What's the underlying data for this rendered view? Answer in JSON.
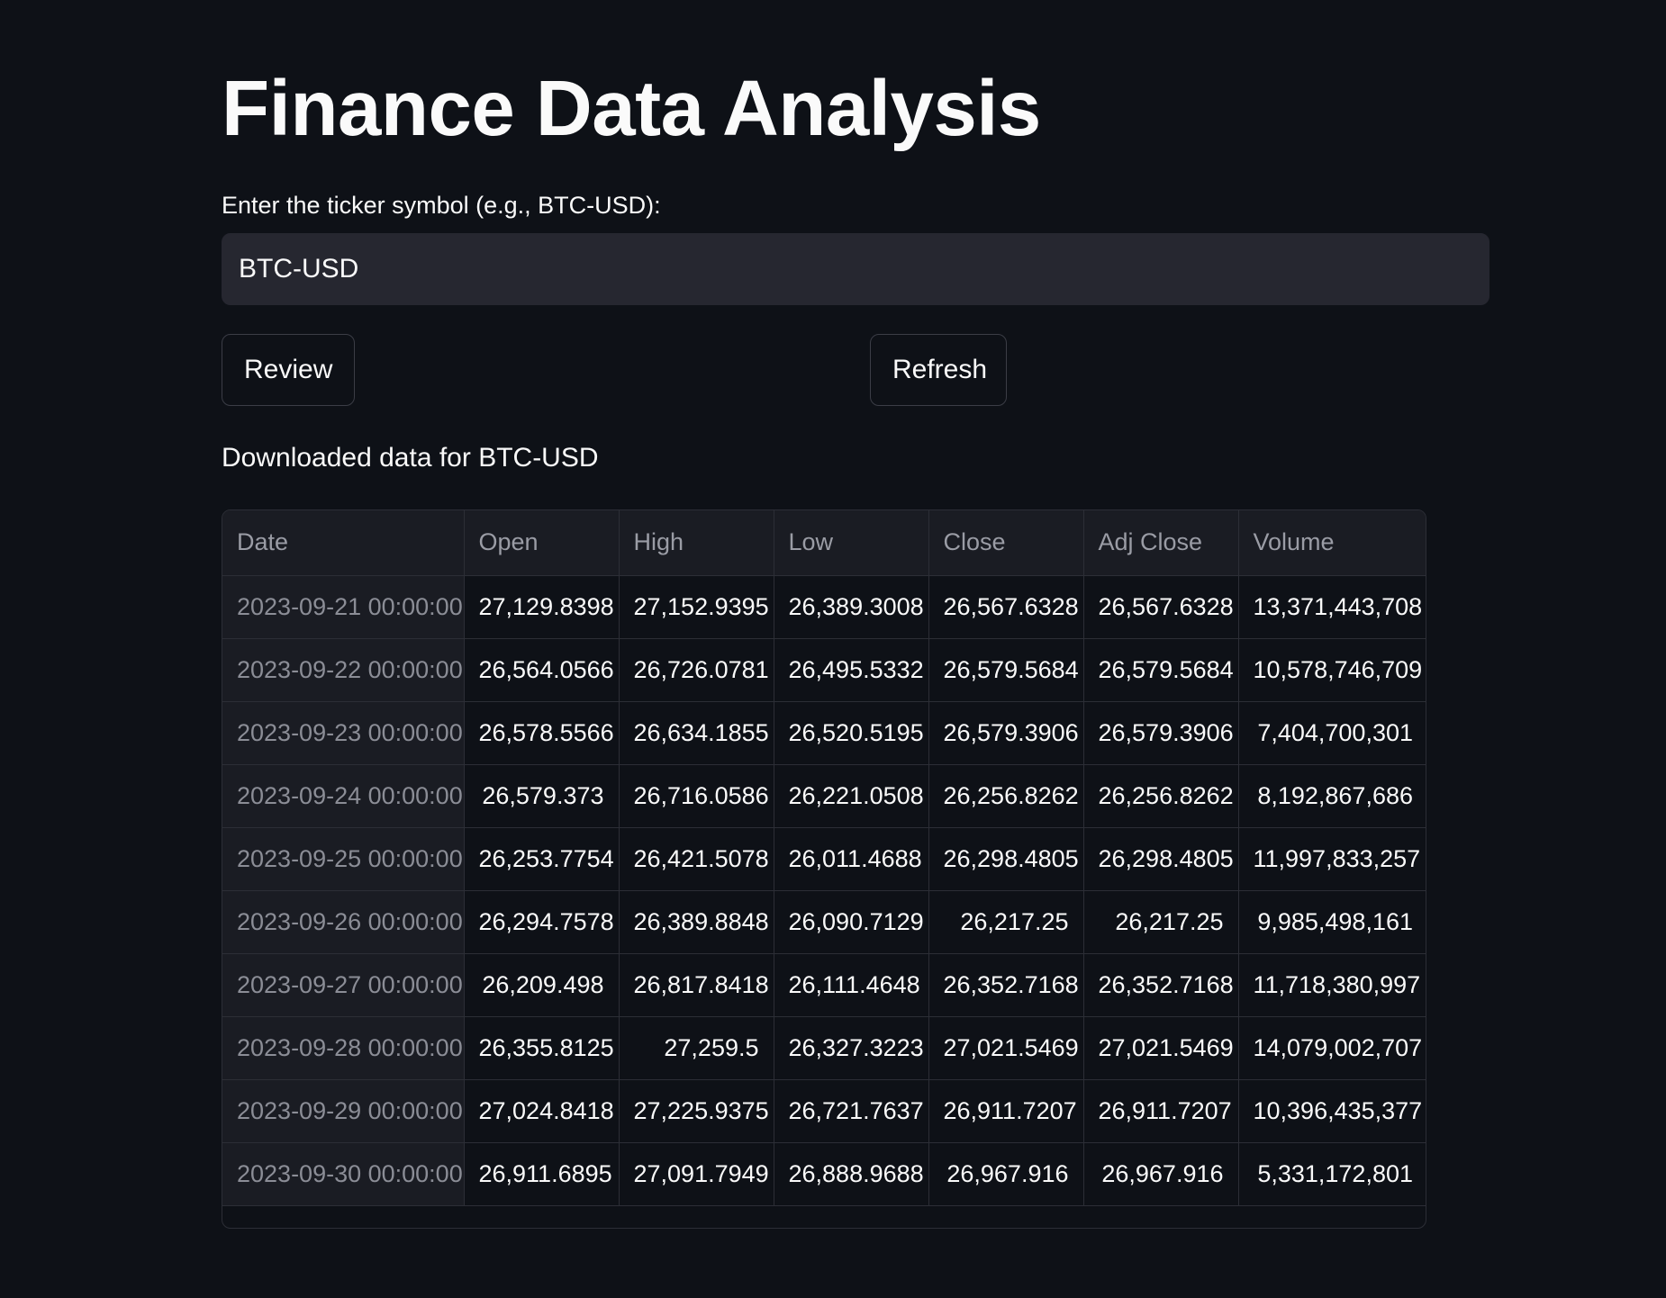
{
  "title": "Finance Data Analysis",
  "ticker_input": {
    "label": "Enter the ticker symbol (e.g., BTC-USD):",
    "value": "BTC-USD"
  },
  "buttons": {
    "review": "Review",
    "refresh": "Refresh"
  },
  "downloaded_text": "Downloaded data for BTC-USD",
  "table": {
    "columns": [
      "Date",
      "Open",
      "High",
      "Low",
      "Close",
      "Adj Close",
      "Volume"
    ],
    "rows": [
      [
        "2023-09-21 00:00:00",
        "27,129.8398",
        "27,152.9395",
        "26,389.3008",
        "26,567.6328",
        "26,567.6328",
        "13,371,443,708"
      ],
      [
        "2023-09-22 00:00:00",
        "26,564.0566",
        "26,726.0781",
        "26,495.5332",
        "26,579.5684",
        "26,579.5684",
        "10,578,746,709"
      ],
      [
        "2023-09-23 00:00:00",
        "26,578.5566",
        "26,634.1855",
        "26,520.5195",
        "26,579.3906",
        "26,579.3906",
        "7,404,700,301"
      ],
      [
        "2023-09-24 00:00:00",
        "26,579.373",
        "26,716.0586",
        "26,221.0508",
        "26,256.8262",
        "26,256.8262",
        "8,192,867,686"
      ],
      [
        "2023-09-25 00:00:00",
        "26,253.7754",
        "26,421.5078",
        "26,011.4688",
        "26,298.4805",
        "26,298.4805",
        "11,997,833,257"
      ],
      [
        "2023-09-26 00:00:00",
        "26,294.7578",
        "26,389.8848",
        "26,090.7129",
        "26,217.25",
        "26,217.25",
        "9,985,498,161"
      ],
      [
        "2023-09-27 00:00:00",
        "26,209.498",
        "26,817.8418",
        "26,111.4648",
        "26,352.7168",
        "26,352.7168",
        "11,718,380,997"
      ],
      [
        "2023-09-28 00:00:00",
        "26,355.8125",
        "27,259.5",
        "26,327.3223",
        "27,021.5469",
        "27,021.5469",
        "14,079,002,707"
      ],
      [
        "2023-09-29 00:00:00",
        "27,024.8418",
        "27,225.9375",
        "26,721.7637",
        "26,911.7207",
        "26,911.7207",
        "10,396,435,377"
      ],
      [
        "2023-09-30 00:00:00",
        "26,911.6895",
        "27,091.7949",
        "26,888.9688",
        "26,967.916",
        "26,967.916",
        "5,331,172,801"
      ]
    ]
  }
}
